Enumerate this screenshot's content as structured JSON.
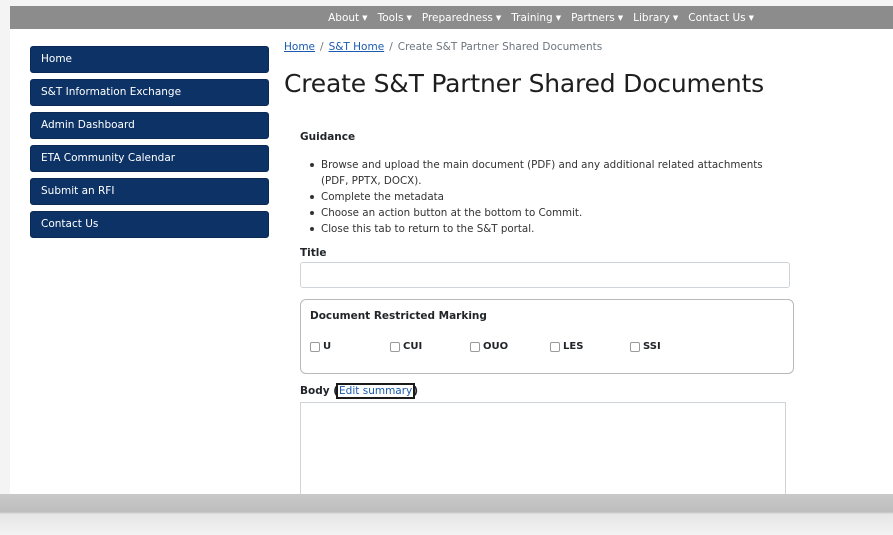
{
  "nav": [
    {
      "label": "About"
    },
    {
      "label": "Tools"
    },
    {
      "label": "Preparedness"
    },
    {
      "label": "Training"
    },
    {
      "label": "Partners"
    },
    {
      "label": "Library"
    },
    {
      "label": "Contact Us"
    }
  ],
  "sidebar": {
    "items": [
      {
        "label": "Home"
      },
      {
        "label": "S&T Information Exchange"
      },
      {
        "label": "Admin Dashboard"
      },
      {
        "label": "ETA Community Calendar"
      },
      {
        "label": "Submit an RFI"
      },
      {
        "label": "Contact Us"
      }
    ]
  },
  "breadcrumb": {
    "home": "Home",
    "sep": "/",
    "st_home": "S&T Home",
    "current": "Create S&T Partner Shared Documents"
  },
  "page": {
    "title": "Create S&T Partner Shared Documents"
  },
  "guidance": {
    "heading": "Guidance",
    "items": [
      "Browse and upload the main document (PDF) and any additional related attachments (PDF, PPTX, DOCX).",
      "Complete the metadata",
      "Choose an action button at the bottom to Commit.",
      "Close this tab to return to the S&T portal."
    ]
  },
  "form": {
    "title_label": "Title",
    "title_value": "",
    "marking": {
      "heading": "Document Restricted Marking",
      "options": [
        {
          "label": "U",
          "checked": false
        },
        {
          "label": "CUI",
          "checked": false
        },
        {
          "label": "OUO",
          "checked": false
        },
        {
          "label": "LES",
          "checked": false
        },
        {
          "label": "SSI",
          "checked": false
        }
      ]
    },
    "body_label": "Body (",
    "edit_summary": "Edit summary",
    "body_label_close": ")"
  },
  "colors": {
    "nav_bg": "#8c8c8c",
    "sidebar_btn": "#0c3266",
    "link": "#1a5bb0"
  }
}
